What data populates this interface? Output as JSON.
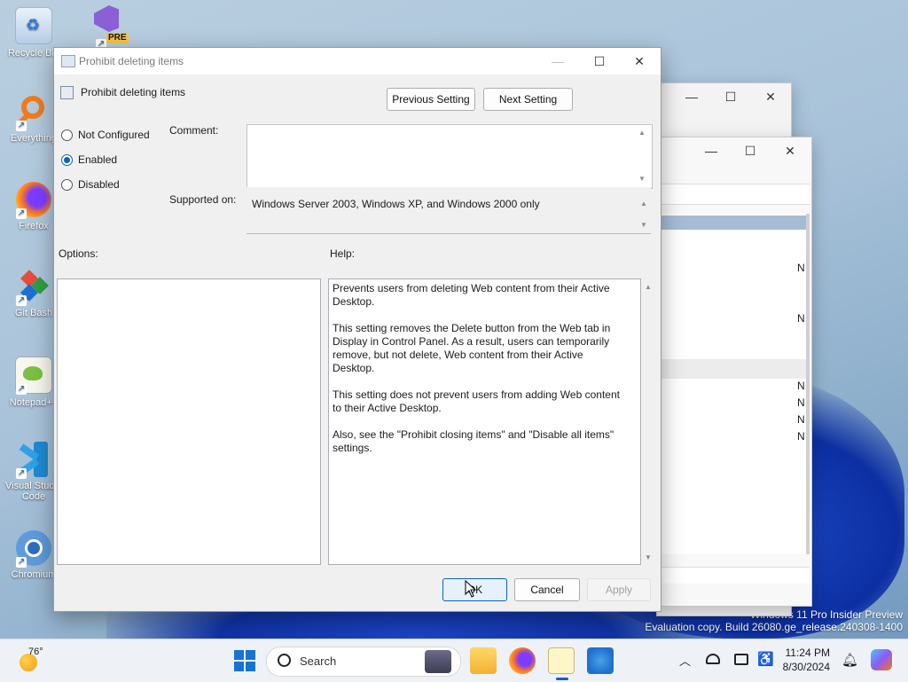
{
  "desktop": {
    "icons": [
      {
        "label": "Recycle Bin"
      },
      {
        "label": "Everything"
      },
      {
        "label": "Firefox"
      },
      {
        "label": "Git Bash"
      },
      {
        "label": "Notepad++"
      },
      {
        "label": "Visual Studio Code"
      },
      {
        "label": "Chromium"
      },
      {
        "label": "PRE"
      }
    ],
    "watermark_line1": "Windows 11 Pro Insider Preview",
    "watermark_line2": "Evaluation copy. Build 26080.ge_release.240308-1400"
  },
  "dialog": {
    "window_title": "Prohibit deleting items",
    "policy_title": "Prohibit deleting items",
    "previous_setting": "Previous Setting",
    "next_setting": "Next Setting",
    "radio_not_configured": "Not Configured",
    "radio_enabled": "Enabled",
    "radio_disabled": "Disabled",
    "selected_state": "Enabled",
    "comment_label": "Comment:",
    "comment_value": "",
    "supported_on_label": "Supported on:",
    "supported_on_value": "Windows Server 2003, Windows XP, and Windows 2000 only",
    "options_label": "Options:",
    "help_label": "Help:",
    "help_p1": "Prevents users from deleting Web content from their Active Desktop.",
    "help_p2": "This setting removes the Delete button from the Web tab in Display in Control Panel. As a result, users can temporarily remove, but not delete, Web content from their Active Desktop.",
    "help_p3": "This setting does not prevent users from adding Web content to their Active Desktop.",
    "help_p4": "Also, see the \"Prohibit closing items\" and \"Disable all items\" settings.",
    "ok": "OK",
    "cancel": "Cancel",
    "apply": "Apply"
  },
  "background_window": {
    "list_letters": [
      "N",
      "N",
      "N",
      "N",
      "N",
      "N"
    ]
  },
  "taskbar": {
    "weather_temp": "76°",
    "search_placeholder": "Search",
    "time": "11:24 PM",
    "date": "8/30/2024"
  },
  "colors": {
    "accent": "#0a62c9",
    "selection": "#a7bcd4"
  }
}
